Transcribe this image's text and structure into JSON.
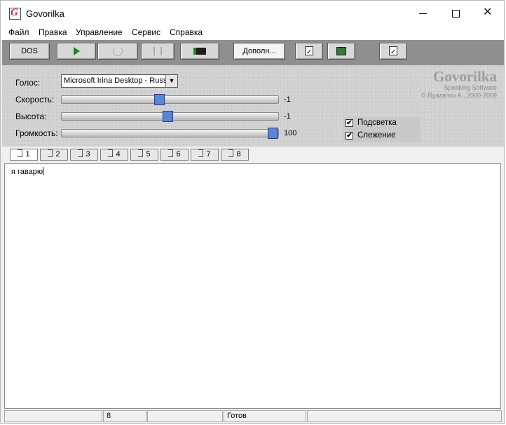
{
  "window": {
    "title": "Govorilka",
    "app_icon_letter": "G"
  },
  "menu": [
    "Файл",
    "Правка",
    "Управление",
    "Сервис",
    "Справка"
  ],
  "toolbar": {
    "dos_label": "DOS",
    "more_label": "Дополн..."
  },
  "controls": {
    "voice_label": "Голос:",
    "voice_value": "Microsoft Irina Desktop - Russian",
    "rate_label": "Скорость:",
    "rate_value": "-1",
    "rate_level": 0.45,
    "pitch_label": "Высота:",
    "pitch_value": "-1",
    "pitch_level": 0.49,
    "volume_label": "Громкость:",
    "volume_value": "100",
    "volume_level": 1.0
  },
  "logo": {
    "title": "Govorilka",
    "subtitle": "Speaking Software",
    "copyright": "© Ryazanov A., 2000-2009"
  },
  "checkboxes": {
    "highlight_label": "Подсветка",
    "highlight_checked": true,
    "tracking_label": "Слежение",
    "tracking_checked": true
  },
  "tabs": [
    "1",
    "2",
    "3",
    "4",
    "5",
    "6",
    "7",
    "8"
  ],
  "editor": {
    "text": "я гаварю"
  },
  "status": {
    "pane2": "8",
    "pane4": "Готов"
  }
}
